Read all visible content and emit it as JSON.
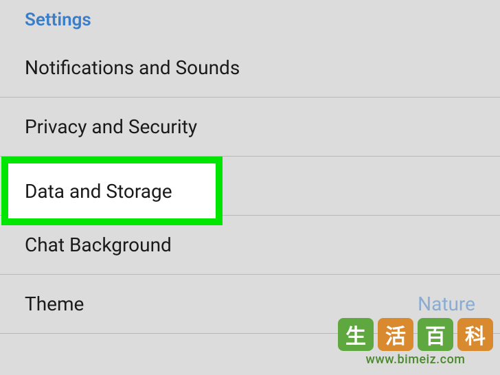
{
  "header": {
    "title": "Settings"
  },
  "items": [
    {
      "label": "Notifications and Sounds"
    },
    {
      "label": "Privacy and Security"
    },
    {
      "label": "Data and Storage"
    },
    {
      "label": "Chat Background"
    },
    {
      "label": "Theme",
      "value": "Nature"
    }
  ],
  "highlight": {
    "label": "Data and Storage"
  },
  "watermark": {
    "char1": "生",
    "char2": "活",
    "char3": "百",
    "char4": "科",
    "url": "www.bimeiz.com"
  }
}
